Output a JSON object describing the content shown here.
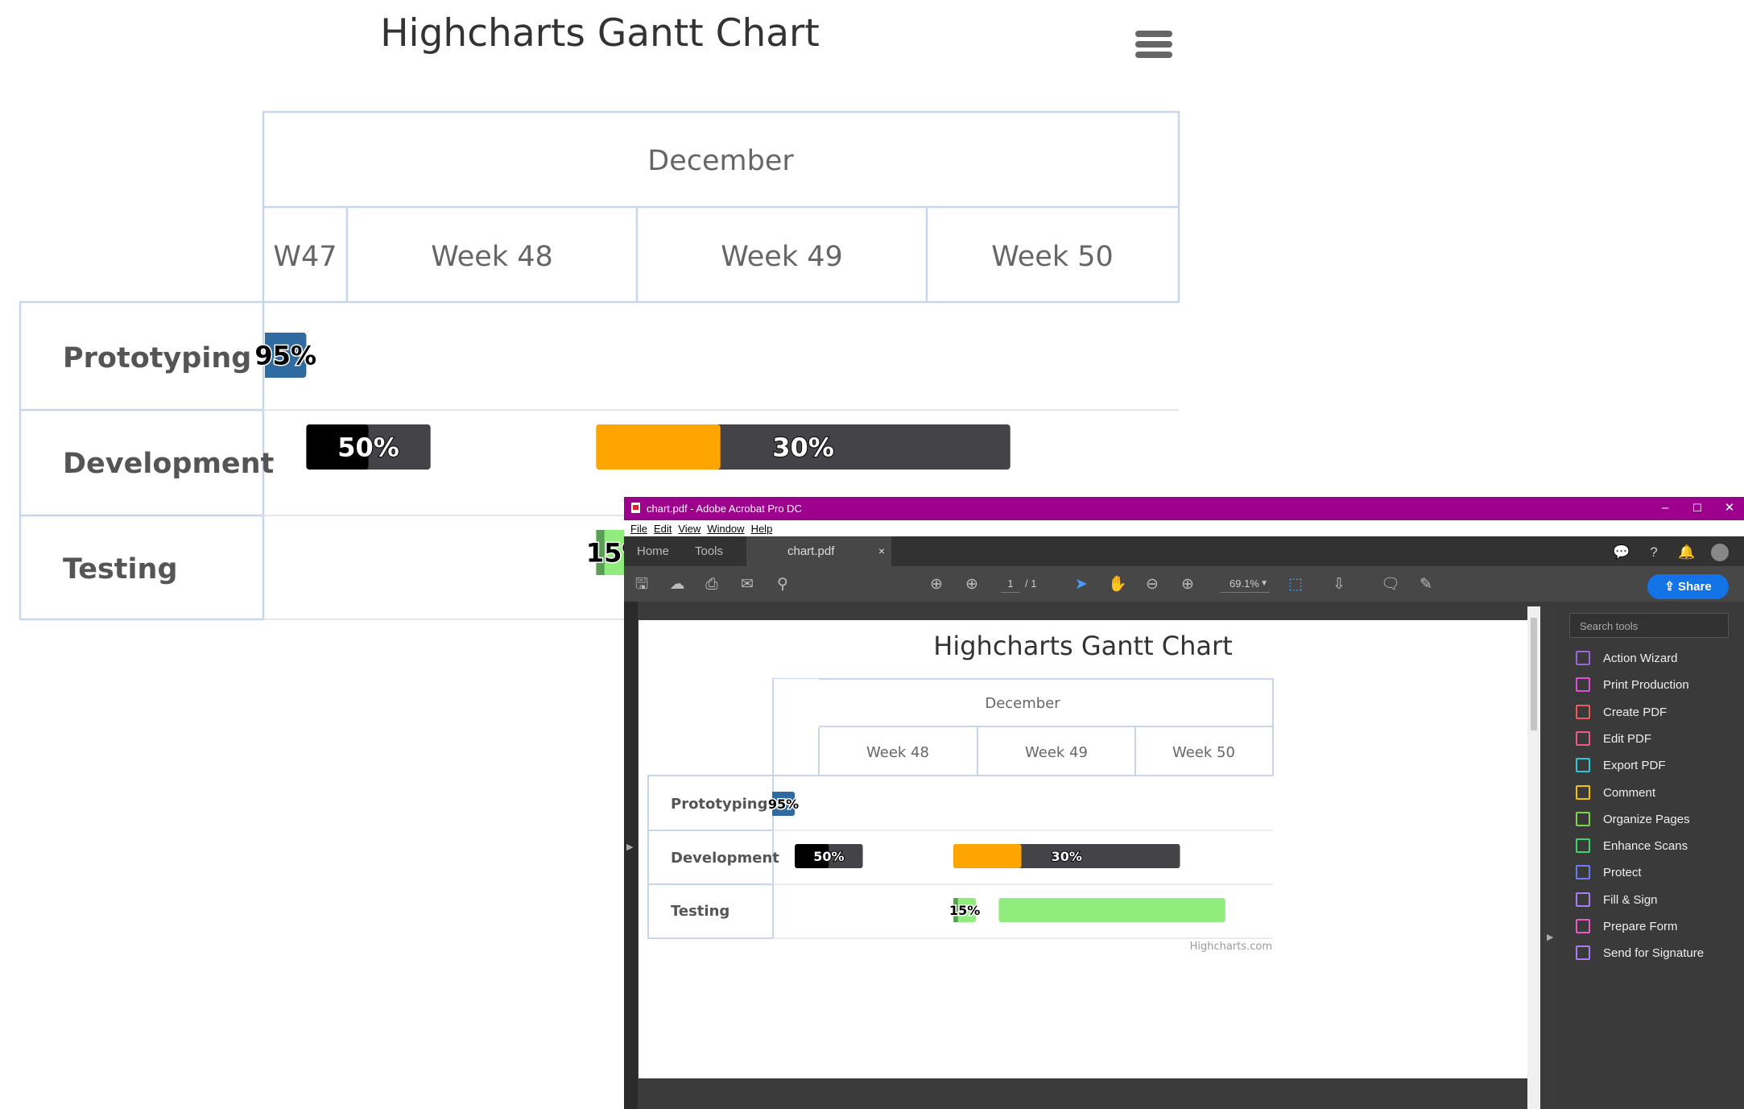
{
  "main_chart": {
    "title": "Highcharts Gantt Chart",
    "menu_icon": "hamburger-menu-icon",
    "header_month": "December",
    "header_weeks": [
      "W47",
      "Week 48",
      "Week 49",
      "Week 50"
    ],
    "categories": [
      "Prototyping",
      "Development",
      "Testing"
    ]
  },
  "pdf_chart": {
    "title": "Highcharts Gantt Chart",
    "header_month": "December",
    "header_weeks": [
      "Week 48",
      "Week 49",
      "Week 50"
    ],
    "categories": [
      "Prototyping",
      "Development",
      "Testing"
    ],
    "credits": "Highcharts.com"
  },
  "chart_data": {
    "type": "gantt",
    "title": "Highcharts Gantt Chart",
    "x_axis": {
      "month": "December",
      "weeks": [
        "W47",
        "Week 48",
        "Week 49",
        "Week 50"
      ]
    },
    "categories": [
      "Prototyping",
      "Development",
      "Testing"
    ],
    "tasks": [
      {
        "category": "Prototyping",
        "start": "2014-11-17",
        "end": "2014-11-18",
        "completed": 0.95,
        "label": "95%",
        "color": "#2f6aa0"
      },
      {
        "category": "Development",
        "start": "2014-11-18",
        "end": "2014-11-21",
        "completed": 0.5,
        "label": "50%",
        "color": "#000000"
      },
      {
        "category": "Development",
        "start": "2014-11-25",
        "end": "2014-12-05",
        "completed": 0.3,
        "label": "30%",
        "color": "#ffa500"
      },
      {
        "category": "Testing",
        "start": "2014-11-25",
        "end": "2014-11-26",
        "completed": 0.15,
        "label": "15%",
        "color": "#90ed7d"
      },
      {
        "category": "Testing",
        "start": "2014-11-27",
        "end": "2014-12-07",
        "completed": null,
        "label": "",
        "color": "#90ed7d"
      }
    ],
    "remaining_color": "#434348",
    "completed_shade_color": "#5a9e55"
  },
  "acrobat": {
    "window_title": "chart.pdf - Adobe Acrobat Pro DC",
    "window_buttons": [
      "–",
      "☐",
      "✕"
    ],
    "menu": [
      "File",
      "Edit",
      "View",
      "Window",
      "Help"
    ],
    "tabs": [
      "Home",
      "Tools"
    ],
    "document_tab": "chart.pdf",
    "document_tab_close": "×",
    "page_current": "1",
    "page_total": "/ 1",
    "zoom": "69.1%",
    "share_label": "Share",
    "search_placeholder": "Search tools",
    "tools": [
      {
        "label": "Action Wizard",
        "color": "#9a68d9"
      },
      {
        "label": "Print Production",
        "color": "#e050d4"
      },
      {
        "label": "Create PDF",
        "color": "#f25a5a"
      },
      {
        "label": "Edit PDF",
        "color": "#ef5a8a"
      },
      {
        "label": "Export PDF",
        "color": "#2cc6d6"
      },
      {
        "label": "Comment",
        "color": "#f5c400"
      },
      {
        "label": "Organize Pages",
        "color": "#7ed64a"
      },
      {
        "label": "Enhance Scans",
        "color": "#3dd46a"
      },
      {
        "label": "Protect",
        "color": "#6d7bf2"
      },
      {
        "label": "Fill & Sign",
        "color": "#a87cf2"
      },
      {
        "label": "Prepare Form",
        "color": "#e85ac4"
      },
      {
        "label": "Send for Signature",
        "color": "#a87cf2"
      }
    ]
  }
}
